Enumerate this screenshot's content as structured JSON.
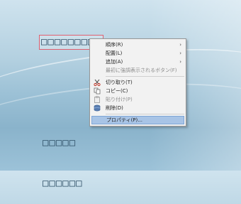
{
  "canvas": {
    "selected_text_object": "□□□□□□□□□",
    "button_text_line1": "□□□□□",
    "button_text_line2": "□□□□□□"
  },
  "context_menu": {
    "items": [
      {
        "label": "順序(R)",
        "has_submenu": true,
        "enabled": true
      },
      {
        "label": "配置(L)",
        "has_submenu": true,
        "enabled": true
      },
      {
        "label": "追加(A)",
        "has_submenu": true,
        "enabled": true
      },
      {
        "label": "最初に強調表示されるボタン(F)",
        "has_submenu": false,
        "enabled": false
      },
      {
        "label": "切り取り(T)",
        "icon": "scissors-icon",
        "enabled": true
      },
      {
        "label": "コピー(C)",
        "icon": "copy-icon",
        "enabled": true
      },
      {
        "label": "貼り付け(P)",
        "icon": "paste-icon",
        "enabled": false
      },
      {
        "label": "削除(D)",
        "icon": "delete-icon",
        "enabled": true
      },
      {
        "label": "プロパティ(P)...",
        "enabled": true,
        "highlighted": true
      }
    ],
    "submenu_arrow": "›"
  },
  "colors": {
    "highlight": "#a8c4e6",
    "selection_border": "#e06070"
  }
}
